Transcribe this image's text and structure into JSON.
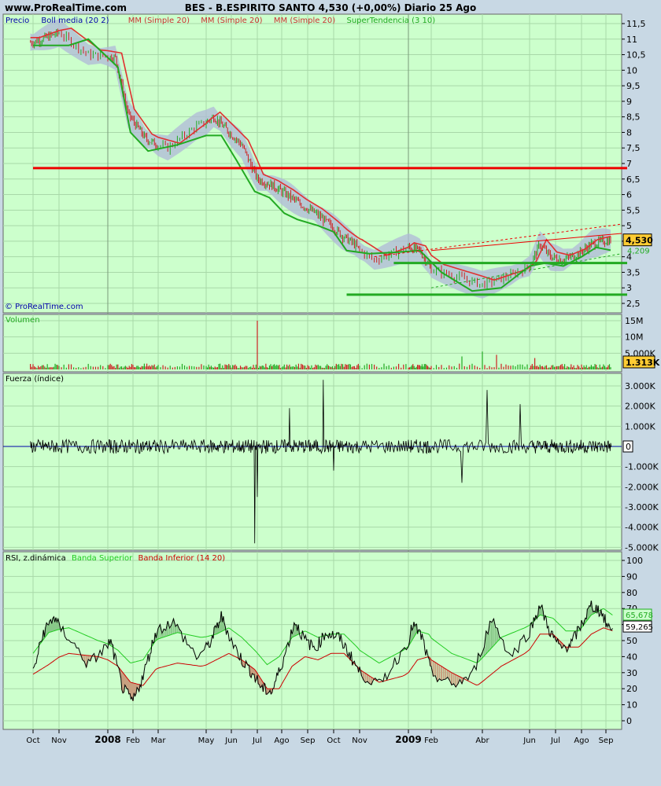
{
  "header": {
    "site": "www.ProRealTime.com",
    "title": "BES - B.ESPIRITO SANTO    4,530 (+0,00%)   Diario  25 Ago"
  },
  "colors": {
    "background": "#c8d8e4",
    "plot_bg": "#ccffcc",
    "price_line": "#c00000",
    "ma_line": "#e03030",
    "supertrend": "#22aa22",
    "boll_band": "#b0b8d8",
    "horizontal_red": "#ee0000",
    "horizontal_green": "#22aa22",
    "volume_up": "#22aa22",
    "volume_down": "#cc2222",
    "rsi_upper": "#22cc22",
    "rsi_lower": "#cc0000"
  },
  "panels": {
    "price": {
      "legend": [
        "Precio",
        "Boll media (20 2)",
        "MM (Simple 20)",
        "MM (Simple 20)",
        "MM (Simple 20)",
        "SuperTendencia (3 10)"
      ],
      "legend_colors": [
        "#0000aa",
        "#0000aa",
        "#cc3333",
        "#cc3333",
        "#cc3333",
        "#22aa22"
      ],
      "watermark": "© ProRealTime.com",
      "y_ticks": [
        "11,5",
        "11",
        "10,5",
        "10",
        "9,5",
        "9",
        "8,5",
        "8",
        "7,5",
        "7",
        "6,5",
        "6",
        "5,5",
        "5",
        "4,5",
        "4",
        "3,5",
        "3",
        "2,5"
      ],
      "last_price_badge": "4,530",
      "last_price_badge2": "4,209"
    },
    "volume": {
      "label": "Volumen",
      "y_ticks": [
        "15M",
        "10M",
        "5.000K"
      ],
      "last_badge": "1.313K"
    },
    "force": {
      "label": "Fuerza (índice)",
      "y_ticks": [
        "3.000K",
        "2.000K",
        "1.000K",
        "0",
        "-1.000K",
        "-2.000K",
        "-3.000K",
        "-4.000K",
        "-5.000K"
      ],
      "zero_badge": "0"
    },
    "rsi": {
      "label_main": "RSI, z.dinámica",
      "label_upper": "Banda Superior",
      "label_lower": "Banda Inferior (14 20)",
      "y_ticks": [
        "100",
        "90",
        "80",
        "70",
        "60",
        "50",
        "40",
        "30",
        "20",
        "10",
        "0"
      ],
      "badge_upper": "65,678",
      "badge_rsi": "59,265"
    }
  },
  "x_axis": {
    "labels": [
      "Oct",
      "Nov",
      "2008",
      "Feb",
      "Mar",
      "May",
      "Jun",
      "Jul",
      "Ago",
      "Sep",
      "Oct",
      "Nov",
      "2009",
      "Feb",
      "Abr",
      "Jun",
      "Jul",
      "Ago",
      "Sep"
    ],
    "bold": [
      "2008",
      "2009"
    ]
  },
  "chart_data": {
    "type": "line",
    "x_label_positions": [
      0,
      1,
      2,
      3,
      4,
      5,
      6,
      7,
      8,
      9,
      10,
      11,
      12,
      13,
      14,
      15,
      16,
      17,
      18
    ],
    "price_anchors": [
      [
        0,
        10.9
      ],
      [
        1,
        11.2
      ],
      [
        1.6,
        10.5
      ],
      [
        2.3,
        10.4
      ],
      [
        2.8,
        8.6
      ],
      [
        3.5,
        7.8
      ],
      [
        4.2,
        7.5
      ],
      [
        4.8,
        8.2
      ],
      [
        5.3,
        8.5
      ],
      [
        5.8,
        8.1
      ],
      [
        6.4,
        7.6
      ],
      [
        7.0,
        6.5
      ],
      [
        7.6,
        6.3
      ],
      [
        8.2,
        6.0
      ],
      [
        8.7,
        5.7
      ],
      [
        9.3,
        5.4
      ],
      [
        9.9,
        5.0
      ],
      [
        10.3,
        4.7
      ],
      [
        10.8,
        4.4
      ],
      [
        11.3,
        3.9
      ],
      [
        12.0,
        4.3
      ],
      [
        12.5,
        4.2
      ],
      [
        13.0,
        3.6
      ],
      [
        13.6,
        3.3
      ],
      [
        14.0,
        3.1
      ],
      [
        14.6,
        3.4
      ],
      [
        15.0,
        3.7
      ],
      [
        15.4,
        4.4
      ],
      [
        15.8,
        4.0
      ],
      [
        16.3,
        3.9
      ],
      [
        16.9,
        4.1
      ],
      [
        17.4,
        4.4
      ],
      [
        17.9,
        4.5
      ],
      [
        18.2,
        4.53
      ]
    ],
    "supertrend_anchors": [
      [
        0,
        10.8
      ],
      [
        1.2,
        10.8
      ],
      [
        1.6,
        11.0
      ],
      [
        2.4,
        10.1
      ],
      [
        2.9,
        8.0
      ],
      [
        3.6,
        7.4
      ],
      [
        4.4,
        7.6
      ],
      [
        5.0,
        7.9
      ],
      [
        5.6,
        7.9
      ],
      [
        6.2,
        7.1
      ],
      [
        6.9,
        6.1
      ],
      [
        7.5,
        5.9
      ],
      [
        8.1,
        5.4
      ],
      [
        8.6,
        5.2
      ],
      [
        9.4,
        5.0
      ],
      [
        10.0,
        4.8
      ],
      [
        10.5,
        4.2
      ],
      [
        11.2,
        4.1
      ],
      [
        11.8,
        4.15
      ],
      [
        12.5,
        4.2
      ],
      [
        13.2,
        3.5
      ],
      [
        13.8,
        2.9
      ],
      [
        14.4,
        3.0
      ],
      [
        15.0,
        3.7
      ],
      [
        15.6,
        3.8
      ],
      [
        16.3,
        3.7
      ],
      [
        17.0,
        4.0
      ],
      [
        17.6,
        4.3
      ],
      [
        18.2,
        4.21
      ]
    ],
    "horizontal_lines": [
      {
        "y": 6.85,
        "x_start": 0,
        "x_end": 18.9,
        "color": "red"
      },
      {
        "y": 3.8,
        "x_start": 11.7,
        "x_end": 18.9,
        "color": "green"
      },
      {
        "y": 2.78,
        "x_start": 10.5,
        "x_end": 18.9,
        "color": "green"
      }
    ],
    "volume_spikes": [
      {
        "x": 7.0,
        "v": 15.0
      },
      {
        "x": 14.0,
        "v": 5.5
      },
      {
        "x": 13.6,
        "v": 4.0
      },
      {
        "x": 14.3,
        "v": 4.5
      },
      {
        "x": 15.2,
        "v": 3.5
      }
    ],
    "force_spikes": [
      {
        "x": 6.9,
        "v": -4.8
      },
      {
        "x": 7.0,
        "v": -2.5
      },
      {
        "x": 8.3,
        "v": 1.9
      },
      {
        "x": 9.6,
        "v": 3.3
      },
      {
        "x": 10.0,
        "v": -1.2
      },
      {
        "x": 13.6,
        "v": -1.8
      },
      {
        "x": 14.1,
        "v": 2.8
      },
      {
        "x": 14.8,
        "v": 2.1
      }
    ],
    "rsi_anchors": [
      [
        0,
        30
      ],
      [
        0.4,
        55
      ],
      [
        0.8,
        65
      ],
      [
        1.2,
        52
      ],
      [
        1.6,
        35
      ],
      [
        2.1,
        50
      ],
      [
        2.6,
        20
      ],
      [
        3.0,
        12
      ],
      [
        3.4,
        28
      ],
      [
        3.9,
        55
      ],
      [
        4.3,
        62
      ],
      [
        4.8,
        40
      ],
      [
        5.2,
        50
      ],
      [
        5.6,
        65
      ],
      [
        6.0,
        50
      ],
      [
        6.4,
        38
      ],
      [
        6.8,
        30
      ],
      [
        7.2,
        20
      ],
      [
        7.6,
        18
      ],
      [
        8.1,
        40
      ],
      [
        8.5,
        62
      ],
      [
        8.9,
        50
      ],
      [
        9.3,
        45
      ],
      [
        9.7,
        55
      ],
      [
        10.2,
        52
      ],
      [
        10.6,
        42
      ],
      [
        11.0,
        30
      ],
      [
        11.4,
        22
      ],
      [
        11.8,
        40
      ],
      [
        12.2,
        60
      ],
      [
        12.6,
        52
      ],
      [
        13.0,
        30
      ],
      [
        13.4,
        22
      ],
      [
        13.8,
        28
      ],
      [
        14.2,
        64
      ],
      [
        14.6,
        40
      ],
      [
        15.0,
        56
      ],
      [
        15.4,
        72
      ],
      [
        15.8,
        55
      ],
      [
        16.2,
        45
      ],
      [
        16.6,
        48
      ],
      [
        17.0,
        60
      ],
      [
        17.4,
        72
      ],
      [
        17.8,
        68
      ],
      [
        18.1,
        58
      ],
      [
        18.3,
        59.3
      ]
    ],
    "rsi_upper_anchors": [
      [
        0,
        42
      ],
      [
        0.6,
        55
      ],
      [
        1.2,
        58
      ],
      [
        1.8,
        50
      ],
      [
        2.4,
        44
      ],
      [
        2.9,
        36
      ],
      [
        3.4,
        38
      ],
      [
        3.9,
        50
      ],
      [
        4.4,
        55
      ],
      [
        4.9,
        52
      ],
      [
        5.4,
        54
      ],
      [
        5.9,
        58
      ],
      [
        6.4,
        52
      ],
      [
        6.9,
        44
      ],
      [
        7.4,
        35
      ],
      [
        7.9,
        40
      ],
      [
        8.4,
        52
      ],
      [
        8.9,
        56
      ],
      [
        9.4,
        52
      ],
      [
        9.9,
        54
      ],
      [
        10.4,
        54
      ],
      [
        10.9,
        46
      ],
      [
        11.4,
        36
      ],
      [
        11.9,
        44
      ],
      [
        12.4,
        56
      ],
      [
        12.9,
        54
      ],
      [
        13.4,
        42
      ],
      [
        13.9,
        36
      ],
      [
        14.4,
        52
      ],
      [
        14.9,
        58
      ],
      [
        15.4,
        66
      ],
      [
        15.9,
        64
      ],
      [
        16.4,
        56
      ],
      [
        16.9,
        56
      ],
      [
        17.4,
        66
      ],
      [
        17.9,
        70
      ],
      [
        18.3,
        65.7
      ]
    ],
    "rsi_lower_anchors": [
      [
        0,
        29
      ],
      [
        0.6,
        35
      ],
      [
        1.2,
        42
      ],
      [
        1.8,
        40
      ],
      [
        2.4,
        34
      ],
      [
        2.9,
        24
      ],
      [
        3.4,
        22
      ],
      [
        3.9,
        32
      ],
      [
        4.4,
        36
      ],
      [
        4.9,
        34
      ],
      [
        5.4,
        38
      ],
      [
        5.9,
        42
      ],
      [
        6.4,
        38
      ],
      [
        6.9,
        32
      ],
      [
        7.4,
        20
      ],
      [
        7.9,
        20
      ],
      [
        8.4,
        34
      ],
      [
        8.9,
        40
      ],
      [
        9.4,
        38
      ],
      [
        9.9,
        42
      ],
      [
        10.4,
        42
      ],
      [
        10.9,
        34
      ],
      [
        11.4,
        24
      ],
      [
        11.9,
        28
      ],
      [
        12.4,
        38
      ],
      [
        12.9,
        40
      ],
      [
        13.4,
        30
      ],
      [
        13.9,
        22
      ],
      [
        14.4,
        34
      ],
      [
        14.9,
        42
      ],
      [
        15.4,
        54
      ],
      [
        15.9,
        54
      ],
      [
        16.4,
        46
      ],
      [
        16.9,
        46
      ],
      [
        17.4,
        54
      ],
      [
        17.9,
        58
      ],
      [
        18.3,
        56
      ]
    ]
  }
}
